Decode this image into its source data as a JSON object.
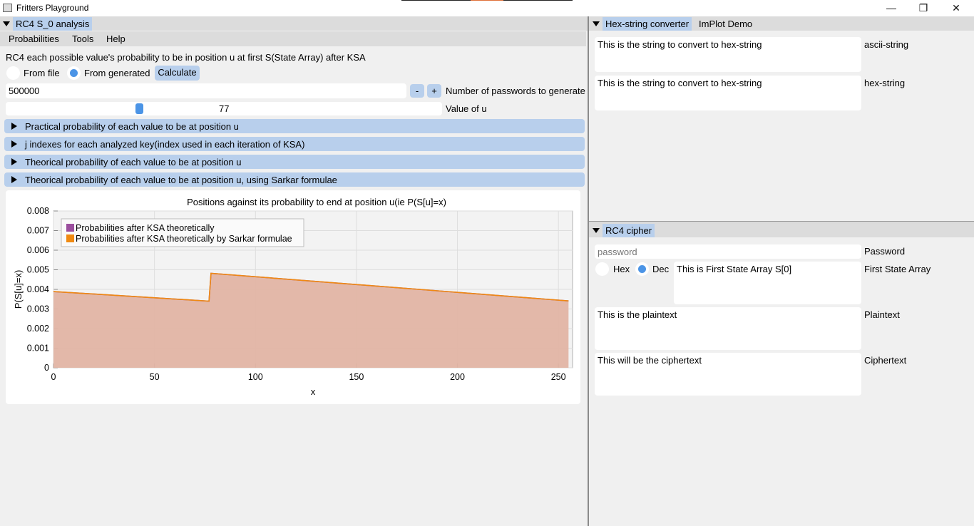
{
  "window": {
    "title": "Fritters Playground",
    "minimize_glyph": "—",
    "maximize_glyph": "❐",
    "close_glyph": "✕"
  },
  "left_panel": {
    "tab_label": "RC4 S_0 analysis",
    "menu": [
      "Probabilities",
      "Tools",
      "Help"
    ],
    "description": "RC4 each possible value's probability to be in position u at first S(State Array) after KSA",
    "radio_from_file": "From file",
    "radio_from_generated": "From generated",
    "selected_source": "From generated",
    "calculate_label": "Calculate",
    "passwords_value": "500000",
    "minus_label": "-",
    "plus_label": "+",
    "passwords_label": "Number of passwords to generate",
    "u_value": "77",
    "u_label": "Value of u",
    "sections": [
      "Practical probability of each value to be at position u",
      "j indexes for each analyzed key(index used in each iteration of KSA)",
      "Theorical probability of each value to be at position u",
      "Theorical probability of each value to be at position u, using Sarkar formulae"
    ]
  },
  "chart_data": {
    "type": "area",
    "title": "Positions against its probability to end at position u(ie P(S[u]=x)",
    "xlabel": "x",
    "ylabel": "P(S[u]=x)",
    "xlim": [
      0,
      257
    ],
    "ylim": [
      0,
      0.008
    ],
    "x_ticks": [
      "0",
      "50",
      "100",
      "150",
      "200",
      "250"
    ],
    "y_ticks": [
      "0",
      "0.001",
      "0.002",
      "0.003",
      "0.004",
      "0.005",
      "0.006",
      "0.007",
      "0.008"
    ],
    "grid": true,
    "legend_position": "top-left",
    "series": [
      {
        "name": "Probabilities after KSA theoretically",
        "color": "#9b4f9e",
        "x": [
          0,
          77,
          78,
          255
        ],
        "y": [
          0.00389,
          0.0034,
          0.00482,
          0.00341
        ]
      },
      {
        "name": "Probabilities after KSA theoretically by Sarkar formulae",
        "color": "#f08a12",
        "x": [
          0,
          77,
          78,
          255
        ],
        "y": [
          0.00389,
          0.0034,
          0.00482,
          0.00341
        ]
      }
    ],
    "fill_color": "#e2b4a4"
  },
  "right_top": {
    "tabs": [
      "Hex-string converter",
      "ImPlot Demo"
    ],
    "ascii_value": "This is the string to convert to hex-string",
    "ascii_label": "ascii-string",
    "hex_value": "This is the string to convert to hex-string",
    "hex_label": "hex-string"
  },
  "right_bottom": {
    "tab_label": "RC4 cipher",
    "password_placeholder": "password",
    "password_label": "Password",
    "radio_hex": "Hex",
    "radio_dec": "Dec",
    "selected_format": "Dec",
    "state_array_value": "This is First State Array S[0]",
    "state_array_label": "First State Array",
    "plaintext_value": "This is the plaintext",
    "plaintext_label": "Plaintext",
    "ciphertext_value": "This will be the ciphertext",
    "ciphertext_label": "Ciphertext"
  }
}
